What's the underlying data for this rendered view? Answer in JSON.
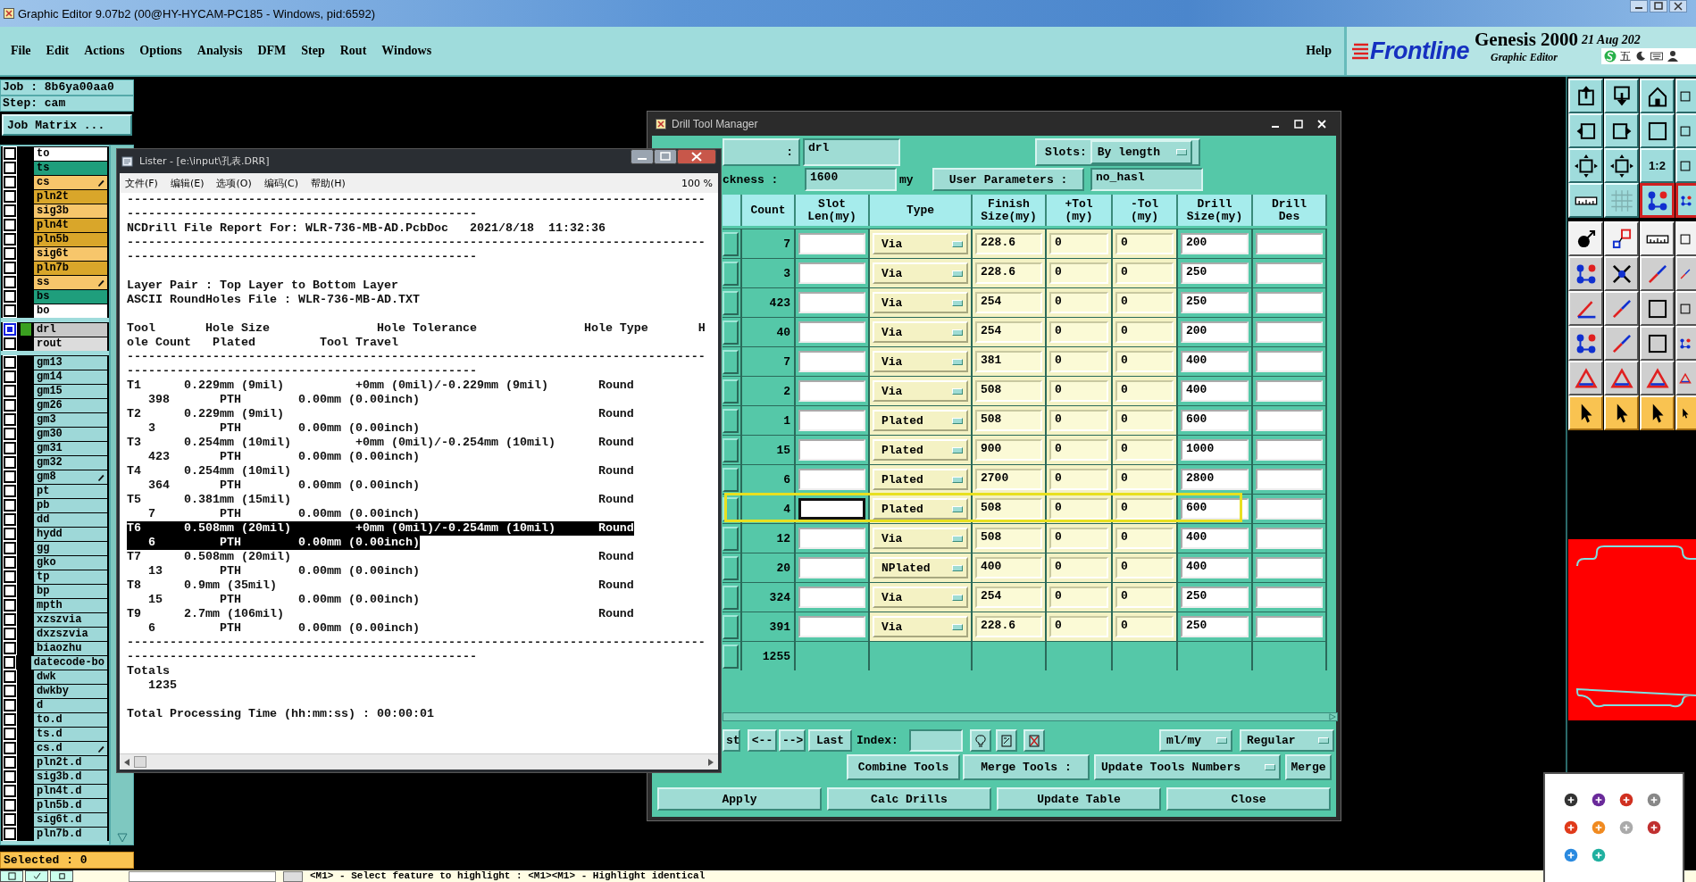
{
  "window": {
    "title": "Graphic Editor 9.07b2 (00@HY-HYCAM-PC185 - Windows, pid:6592)"
  },
  "menu": [
    "File",
    "Edit",
    "Actions",
    "Options",
    "Analysis",
    "DFM",
    "Step",
    "Rout",
    "Windows"
  ],
  "help": "Help",
  "brand": {
    "logo": "Frontline",
    "product": "Genesis 2000",
    "subtitle": "Graphic Editor",
    "date": "21 Aug 202"
  },
  "ime_bar": {
    "label": "五"
  },
  "toolbar": {
    "scale_label": "1:2"
  },
  "job_panel": {
    "job": "Job : 8b6ya00aa0",
    "step": "Step: cam",
    "matrix_button": "Job Matrix ..."
  },
  "layer_groups": [
    {
      "layers": [
        {
          "name": "to",
          "color": "#ffffff",
          "marked": false,
          "selected": false
        },
        {
          "name": "ts",
          "color": "#1f9e7c",
          "marked": false,
          "selected": false
        },
        {
          "name": "cs",
          "color": "#f7c66b",
          "marked": true,
          "selected": false
        },
        {
          "name": "pln2t",
          "color": "#d9a62a",
          "marked": false,
          "selected": false
        },
        {
          "name": "sig3b",
          "color": "#f7c66b",
          "marked": false,
          "selected": false
        },
        {
          "name": "pln4t",
          "color": "#d9a62a",
          "marked": false,
          "selected": false
        },
        {
          "name": "pln5b",
          "color": "#d9a62a",
          "marked": false,
          "selected": false
        },
        {
          "name": "sig6t",
          "color": "#f7c66b",
          "marked": false,
          "selected": false
        },
        {
          "name": "pln7b",
          "color": "#d9a62a",
          "marked": false,
          "selected": false
        },
        {
          "name": "ss",
          "color": "#f7c66b",
          "marked": true,
          "selected": false
        },
        {
          "name": "bs",
          "color": "#1f9e7c",
          "marked": false,
          "selected": false
        },
        {
          "name": "bo",
          "color": "#ffffff",
          "marked": false,
          "selected": false
        }
      ]
    },
    {
      "layers": [
        {
          "name": "drl",
          "color": "#c8c8c8",
          "marked": false,
          "selected": true
        },
        {
          "name": "rout",
          "color": "#dcdcdc",
          "marked": false,
          "selected": false
        }
      ]
    },
    {
      "layers": [
        {
          "name": "gm13",
          "color": "#9ed8d8",
          "marked": false,
          "selected": false
        },
        {
          "name": "gm14",
          "color": "#9ed8d8",
          "marked": false,
          "selected": false
        },
        {
          "name": "gm15",
          "color": "#9ed8d8",
          "marked": false,
          "selected": false
        },
        {
          "name": "gm26",
          "color": "#9ed8d8",
          "marked": false,
          "selected": false
        },
        {
          "name": "gm3",
          "color": "#9ed8d8",
          "marked": false,
          "selected": false
        },
        {
          "name": "gm30",
          "color": "#9ed8d8",
          "marked": false,
          "selected": false
        },
        {
          "name": "gm31",
          "color": "#9ed8d8",
          "marked": false,
          "selected": false
        },
        {
          "name": "gm32",
          "color": "#9ed8d8",
          "marked": false,
          "selected": false
        },
        {
          "name": "gm8",
          "color": "#9ed8d8",
          "marked": true,
          "selected": false
        },
        {
          "name": "pt",
          "color": "#9ed8d8",
          "marked": false,
          "selected": false
        },
        {
          "name": "pb",
          "color": "#9ed8d8",
          "marked": false,
          "selected": false
        },
        {
          "name": "dd",
          "color": "#9ed8d8",
          "marked": false,
          "selected": false
        },
        {
          "name": "hydd",
          "color": "#9ed8d8",
          "marked": false,
          "selected": false
        },
        {
          "name": "gg",
          "color": "#9ed8d8",
          "marked": false,
          "selected": false
        },
        {
          "name": "gko",
          "color": "#9ed8d8",
          "marked": false,
          "selected": false
        },
        {
          "name": "tp",
          "color": "#9ed8d8",
          "marked": false,
          "selected": false
        },
        {
          "name": "bp",
          "color": "#9ed8d8",
          "marked": false,
          "selected": false
        },
        {
          "name": "mpth",
          "color": "#9ed8d8",
          "marked": false,
          "selected": false
        },
        {
          "name": "xzszvia",
          "color": "#9ed8d8",
          "marked": false,
          "selected": false
        },
        {
          "name": "dxzszvia",
          "color": "#9ed8d8",
          "marked": false,
          "selected": false
        },
        {
          "name": "biaozhu",
          "color": "#9ed8d8",
          "marked": false,
          "selected": false
        },
        {
          "name": "datecode-bo",
          "color": "#9ed8d8",
          "marked": false,
          "selected": false
        },
        {
          "name": "dwk",
          "color": "#9ed8d8",
          "marked": false,
          "selected": false
        },
        {
          "name": "dwkby",
          "color": "#9ed8d8",
          "marked": false,
          "selected": false
        },
        {
          "name": "d",
          "color": "#9ed8d8",
          "marked": false,
          "selected": false
        },
        {
          "name": "to.d",
          "color": "#9ed8d8",
          "marked": false,
          "selected": false
        },
        {
          "name": "ts.d",
          "color": "#9ed8d8",
          "marked": false,
          "selected": false
        },
        {
          "name": "cs.d",
          "color": "#9ed8d8",
          "marked": true,
          "selected": false
        },
        {
          "name": "pln2t.d",
          "color": "#9ed8d8",
          "marked": false,
          "selected": false
        },
        {
          "name": "sig3b.d",
          "color": "#9ed8d8",
          "marked": false,
          "selected": false
        },
        {
          "name": "pln4t.d",
          "color": "#9ed8d8",
          "marked": false,
          "selected": false
        },
        {
          "name": "pln5b.d",
          "color": "#9ed8d8",
          "marked": false,
          "selected": false
        },
        {
          "name": "sig6t.d",
          "color": "#9ed8d8",
          "marked": false,
          "selected": false
        },
        {
          "name": "pln7b.d",
          "color": "#9ed8d8",
          "marked": false,
          "selected": false
        }
      ]
    }
  ],
  "selected_count": "Selected : 0",
  "lister": {
    "title": "Lister - [e:\\input\\孔表.DRR]",
    "menu": [
      "文件(F)",
      "编辑(E)",
      "选项(O)",
      "编码(C)",
      "帮助(H)"
    ],
    "zoom": "100 %",
    "blocks": [
      [
        {
          "text": "---------------------------------------------------------------------------------",
          "selected": false
        },
        {
          "text": "-------------------------------------------------",
          "selected": false
        },
        {
          "text": "NCDrill File Report For: WLR-736-MB-AD.PcbDoc   2021/8/18  11:32:36",
          "selected": false
        },
        {
          "text": "---------------------------------------------------------------------------------",
          "selected": false
        },
        {
          "text": "-------------------------------------------------",
          "selected": false
        }
      ],
      [
        {
          "text": "Layer Pair : Top Layer to Bottom Layer",
          "selected": false
        },
        {
          "text": "ASCII RoundHoles File : WLR-736-MB-AD.TXT",
          "selected": false
        }
      ],
      [
        {
          "text": "Tool       Hole Size               Hole Tolerance               Hole Type       H",
          "selected": false
        },
        {
          "text": "ole Count   Plated         Tool Travel",
          "selected": false
        },
        {
          "text": "---------------------------------------------------------------------------------",
          "selected": false
        },
        {
          "text": "-------------------------------------------------",
          "selected": false
        },
        {
          "text": "T1      0.229mm (9mil)          +0mm (0mil)/-0.229mm (9mil)       Round",
          "selected": false
        },
        {
          "text": "   398       PTH        0.00mm (0.00inch)",
          "selected": false
        },
        {
          "text": "T2      0.229mm (9mil)                                            Round",
          "selected": false
        },
        {
          "text": "   3         PTH        0.00mm (0.00inch)",
          "selected": false
        },
        {
          "text": "T3      0.254mm (10mil)         +0mm (0mil)/-0.254mm (10mil)      Round",
          "selected": false
        },
        {
          "text": "   423       PTH        0.00mm (0.00inch)",
          "selected": false
        },
        {
          "text": "T4      0.254mm (10mil)                                           Round",
          "selected": false
        },
        {
          "text": "   364       PTH        0.00mm (0.00inch)",
          "selected": false
        },
        {
          "text": "T5      0.381mm (15mil)                                           Round",
          "selected": false
        },
        {
          "text": "   7         PTH        0.00mm (0.00inch)",
          "selected": false
        },
        {
          "text": "T6      0.508mm (20mil)         +0mm (0mil)/-0.254mm (10mil)      Round",
          "selected": true
        },
        {
          "text": "   6         PTH        0.00mm (0.00inch)",
          "selected": true
        },
        {
          "text": "T7      0.508mm (20mil)                                           Round",
          "selected": false
        },
        {
          "text": "   13        PTH        0.00mm (0.00inch)",
          "selected": false
        },
        {
          "text": "T8      0.9mm (35mil)                                             Round",
          "selected": false
        },
        {
          "text": "   15        PTH        0.00mm (0.00inch)",
          "selected": false
        },
        {
          "text": "T9      2.7mm (106mil)                                            Round",
          "selected": false
        },
        {
          "text": "   6         PTH        0.00mm (0.00inch)",
          "selected": false
        },
        {
          "text": "---------------------------------------------------------------------------------",
          "selected": false
        },
        {
          "text": "-------------------------------------------------",
          "selected": false
        },
        {
          "text": "Totals",
          "selected": false
        },
        {
          "text": "   1235",
          "selected": false
        }
      ],
      [
        {
          "text": "Total Processing Time (hh:mm:ss) : 00:00:01",
          "selected": false
        }
      ]
    ]
  },
  "drill_tool_manager": {
    "title": "Drill Tool Manager",
    "layer_label": ":",
    "layer_value": "drl",
    "slots_label": "Slots:",
    "slots_value": "By length",
    "thickness_label": "ckness :",
    "thickness_value": "1600",
    "thickness_unit": "my",
    "user_params_button": "User Parameters :",
    "user_params_value": "no_hasl",
    "columns": [
      "Count",
      "Slot\nLen(my)",
      "Type",
      "Finish\nSize(my)",
      "+Tol\n(my)",
      "-Tol\n(my)",
      "Drill\nSize(my)",
      "Drill\nDes"
    ],
    "rows": [
      {
        "count": "7",
        "type": "Via",
        "finish": "228.6",
        "plus_tol": "0",
        "minus_tol": "0",
        "drill_size": "200",
        "selected": false
      },
      {
        "count": "3",
        "type": "Via",
        "finish": "228.6",
        "plus_tol": "0",
        "minus_tol": "0",
        "drill_size": "250",
        "selected": false
      },
      {
        "count": "423",
        "type": "Via",
        "finish": "254",
        "plus_tol": "0",
        "minus_tol": "0",
        "drill_size": "250",
        "selected": false
      },
      {
        "count": "40",
        "type": "Via",
        "finish": "254",
        "plus_tol": "0",
        "minus_tol": "0",
        "drill_size": "200",
        "selected": false
      },
      {
        "count": "7",
        "type": "Via",
        "finish": "381",
        "plus_tol": "0",
        "minus_tol": "0",
        "drill_size": "400",
        "selected": false
      },
      {
        "count": "2",
        "type": "Via",
        "finish": "508",
        "plus_tol": "0",
        "minus_tol": "0",
        "drill_size": "400",
        "selected": false
      },
      {
        "count": "1",
        "type": "Plated",
        "finish": "508",
        "plus_tol": "0",
        "minus_tol": "0",
        "drill_size": "600",
        "selected": false
      },
      {
        "count": "15",
        "type": "Plated",
        "finish": "900",
        "plus_tol": "0",
        "minus_tol": "0",
        "drill_size": "1000",
        "selected": false
      },
      {
        "count": "6",
        "type": "Plated",
        "finish": "2700",
        "plus_tol": "0",
        "minus_tol": "0",
        "drill_size": "2800",
        "selected": false
      },
      {
        "count": "4",
        "type": "Plated",
        "finish": "508",
        "plus_tol": "0",
        "minus_tol": "0",
        "drill_size": "600",
        "selected": true
      },
      {
        "count": "12",
        "type": "Via",
        "finish": "508",
        "plus_tol": "0",
        "minus_tol": "0",
        "drill_size": "400",
        "selected": false
      },
      {
        "count": "20",
        "type": "NPlated",
        "finish": "400",
        "plus_tol": "0",
        "minus_tol": "0",
        "drill_size": "400",
        "selected": false
      },
      {
        "count": "324",
        "type": "Via",
        "finish": "254",
        "plus_tol": "0",
        "minus_tol": "0",
        "drill_size": "250",
        "selected": false
      },
      {
        "count": "391",
        "type": "Via",
        "finish": "228.6",
        "plus_tol": "0",
        "minus_tol": "0",
        "drill_size": "250",
        "selected": false
      }
    ],
    "total": "1255",
    "nav": {
      "first": "st",
      "prev": "<--",
      "next": "-->",
      "last": "Last",
      "index_label": "Index:",
      "units": "ml/my",
      "mode": "Regular"
    },
    "combine": "Combine Tools",
    "merge_label": "Merge Tools :",
    "update_numbers": "Update Tools Numbers",
    "merge": "Merge",
    "actions": [
      "Apply",
      "Calc Drills",
      "Update Table",
      "Close"
    ]
  },
  "status_bar": {
    "message": "<M1> - Select feature to highlight : <M1><M1> - Highlight identical"
  }
}
